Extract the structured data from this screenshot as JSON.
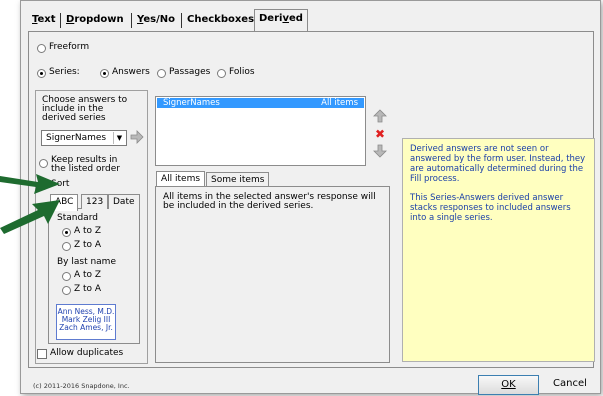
{
  "tabs": [
    {
      "label": "Text",
      "ul": "T",
      "rest": "ext"
    },
    {
      "label": "Dropdown",
      "ul": "D",
      "rest": "ropdown"
    },
    {
      "label": "Yes/No",
      "ul": "Y",
      "rest": "es/No"
    },
    {
      "label": "Checkboxes",
      "ul": "",
      "rest": "Checkboxes"
    },
    {
      "label": "Derived",
      "pre": "Deri",
      "ul": "v",
      "rest": "ed"
    }
  ],
  "radios_top": {
    "freeform": "Freeform",
    "series": "Series:",
    "answers": "Answers",
    "passages": "Passages",
    "folios": "Folios"
  },
  "left_panel": {
    "choose_label": "Choose answers to include in the derived series",
    "combo_value": "SignerNames",
    "keep_order": "Keep results in the listed order",
    "sort": "Sort",
    "sort_tabs": [
      "ABC",
      "123",
      "Date"
    ],
    "standard": "Standard",
    "a_to_z": "A to Z",
    "z_to_a": "Z to A",
    "by_last_name": "By last name",
    "a_to_z_2": "A to Z",
    "z_to_a_2": "Z to A",
    "names": [
      "Ann Ness, M.D.",
      "Mark Zelig III",
      "Zach Ames, Jr."
    ],
    "allow_duplicates": "Allow duplicates"
  },
  "list": {
    "row_name": "SignerNames",
    "row_value": "All items"
  },
  "items_tabs": [
    "All items",
    "Some items"
  ],
  "items_desc": "All items in the selected answer's response will be included in the derived series.",
  "info": {
    "p1": "Derived answers are not seen or answered by the form user.  Instead, they are automatically determined during the Fill process.",
    "p2": "This Series-Answers derived answer stacks responses to included answers into a single series."
  },
  "footer": {
    "copyright": "(c) 2011-2016 Snapdone, Inc.",
    "ok": "OK",
    "cancel": "Cancel"
  },
  "colors": {
    "selection": "#3399ff",
    "arrow": "#1e6b2f",
    "info_bg": "#ffffc0",
    "info_text": "#1a3fa8"
  }
}
